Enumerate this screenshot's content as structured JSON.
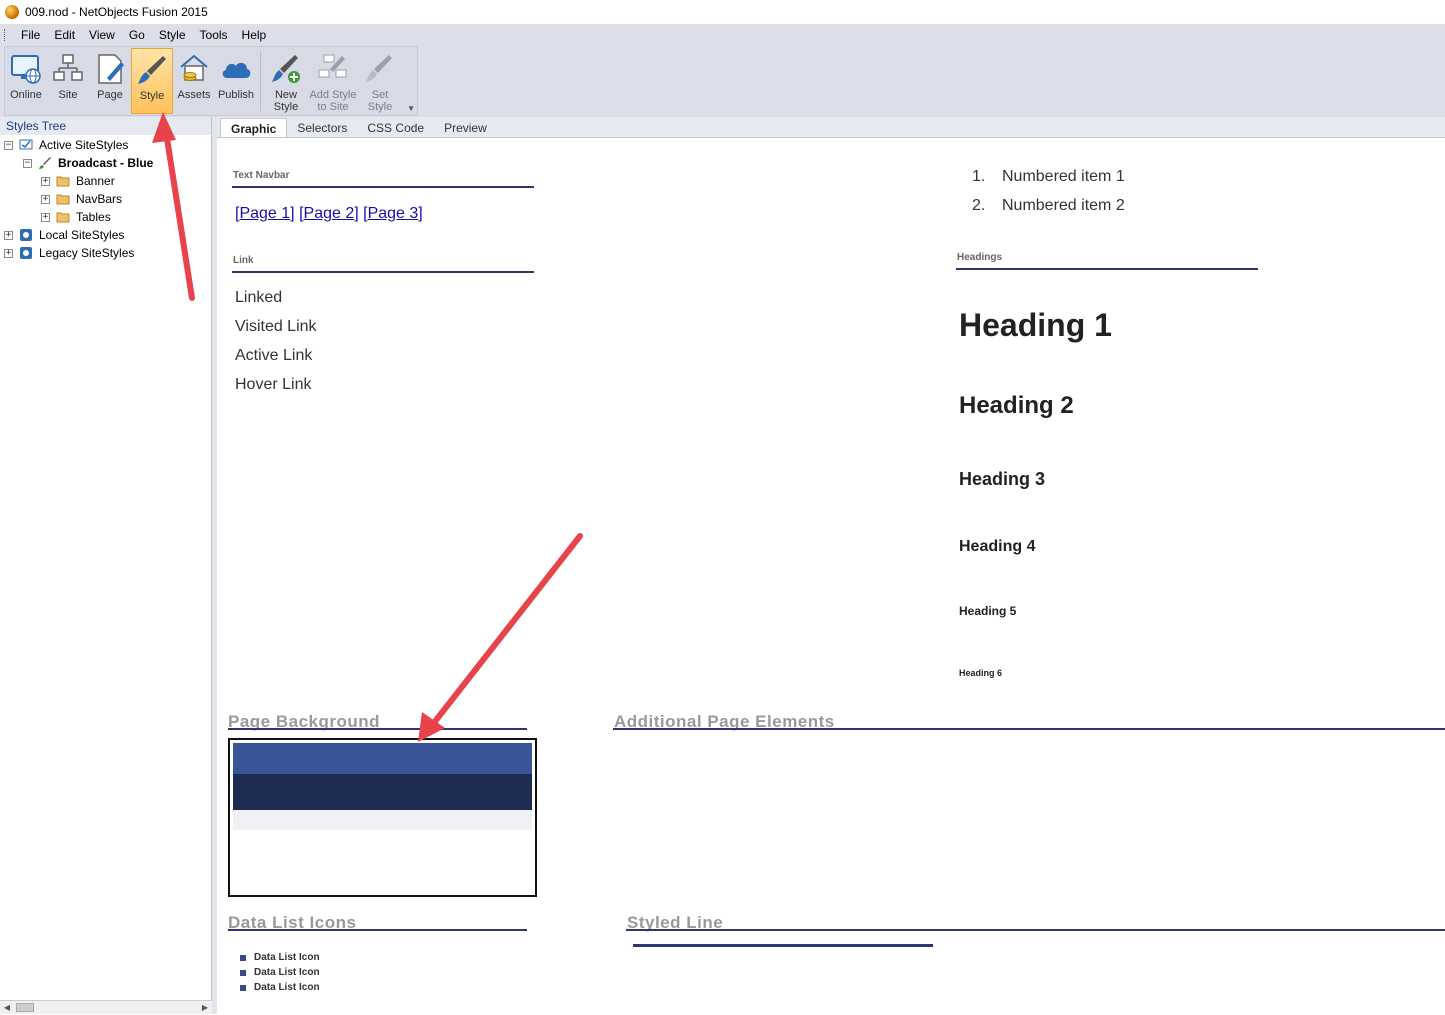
{
  "window": {
    "title": "009.nod - NetObjects Fusion 2015"
  },
  "menu": [
    "File",
    "Edit",
    "View",
    "Go",
    "Style",
    "Tools",
    "Help"
  ],
  "ribbon": {
    "buttons": [
      {
        "label": "Online",
        "icon": "monitor-globe-icon"
      },
      {
        "label": "Site",
        "icon": "sitemap-icon"
      },
      {
        "label": "Page",
        "icon": "page-pencil-icon"
      },
      {
        "label": "Style",
        "icon": "paintbrush-icon",
        "active": true
      },
      {
        "label": "Assets",
        "icon": "house-coins-icon"
      },
      {
        "label": "Publish",
        "icon": "cloud-icon"
      }
    ],
    "style_buttons": [
      {
        "line1": "New",
        "line2": "Style",
        "icon": "new-style-icon"
      },
      {
        "line1": "Add Style",
        "line2": "to Site",
        "icon": "add-style-icon"
      },
      {
        "line1": "Set",
        "line2": "Style",
        "icon": "set-style-icon"
      }
    ]
  },
  "styles_tree": {
    "header": "Styles Tree",
    "items": [
      {
        "label": "Active SiteStyles",
        "expander": "−"
      },
      {
        "label": "Broadcast - Blue",
        "expander": "−"
      },
      {
        "label": "Banner",
        "expander": "+"
      },
      {
        "label": "NavBars",
        "expander": "+"
      },
      {
        "label": "Tables",
        "expander": "+"
      },
      {
        "label": "Local SiteStyles",
        "expander": "+"
      },
      {
        "label": "Legacy SiteStyles",
        "expander": "+"
      }
    ]
  },
  "tabs": [
    "Graphic",
    "Selectors",
    "CSS Code",
    "Preview"
  ],
  "canvas": {
    "text_navbar": {
      "label": "Text Navbar",
      "links": [
        "Page 1",
        "Page 2",
        "Page 3"
      ]
    },
    "link_section": {
      "label": "Link",
      "items": [
        "Linked",
        "Visited Link",
        "Active Link",
        "Hover Link"
      ]
    },
    "numbered_list": [
      {
        "num": "1.",
        "text": "Numbered item 1"
      },
      {
        "num": "2.",
        "text": "Numbered item 2"
      }
    ],
    "headings": {
      "label": "Headings",
      "items": [
        "Heading 1",
        "Heading 2",
        "Heading 3",
        "Heading 4",
        "Heading 5",
        "Heading 6"
      ]
    },
    "page_background": {
      "label": "Page Background"
    },
    "additional_elements": {
      "label": "Additional Page Elements"
    },
    "data_list_icons": {
      "label": "Data List Icons",
      "items": [
        "Data List Icon",
        "Data List Icon",
        "Data List Icon"
      ]
    },
    "styled_line": {
      "label": "Styled Line"
    }
  },
  "colors": {
    "accent_navy": "#2e3570",
    "band_blue": "#3a5597",
    "band_dark": "#1e2c52",
    "annotation_arrow": "#e8434a"
  }
}
